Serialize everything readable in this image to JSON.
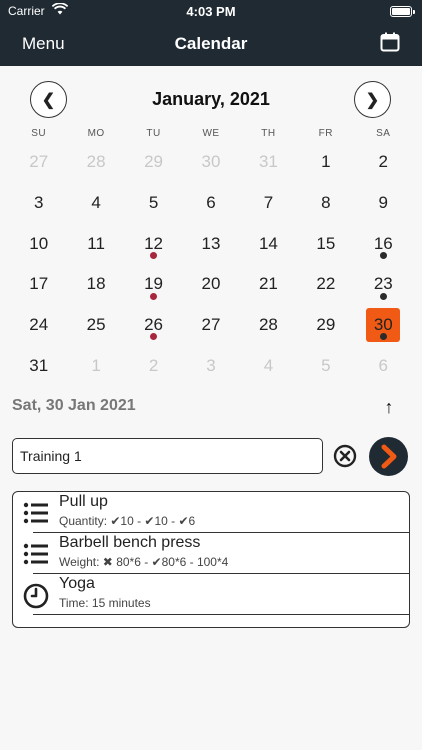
{
  "status_bar": {
    "carrier": "Carrier",
    "time": "4:03 PM",
    "wifi_icon": "wifi-icon",
    "battery_icon": "battery-icon"
  },
  "nav": {
    "left_label": "Menu",
    "title": "Calendar",
    "right_icon": "calendar-icon"
  },
  "month": {
    "title": "January, 2021",
    "prev_icon": "chevron-left-icon",
    "next_icon": "chevron-right-icon"
  },
  "weekdays": [
    "SU",
    "MO",
    "TU",
    "WE",
    "TH",
    "FR",
    "SA"
  ],
  "colors": {
    "nav_bg": "#1f2a33",
    "selected": "#f05a14",
    "dot_red": "#a8263e",
    "dot_dark": "#2b2b2b"
  },
  "days": [
    {
      "n": "27",
      "muted": true
    },
    {
      "n": "28",
      "muted": true
    },
    {
      "n": "29",
      "muted": true
    },
    {
      "n": "30",
      "muted": true
    },
    {
      "n": "31",
      "muted": true
    },
    {
      "n": "1"
    },
    {
      "n": "2"
    },
    {
      "n": "3"
    },
    {
      "n": "4"
    },
    {
      "n": "5"
    },
    {
      "n": "6"
    },
    {
      "n": "7"
    },
    {
      "n": "8"
    },
    {
      "n": "9"
    },
    {
      "n": "10"
    },
    {
      "n": "11"
    },
    {
      "n": "12",
      "dot": "red"
    },
    {
      "n": "13"
    },
    {
      "n": "14"
    },
    {
      "n": "15"
    },
    {
      "n": "16",
      "dot": "dark"
    },
    {
      "n": "17"
    },
    {
      "n": "18"
    },
    {
      "n": "19",
      "dot": "red"
    },
    {
      "n": "20"
    },
    {
      "n": "21"
    },
    {
      "n": "22"
    },
    {
      "n": "23",
      "dot": "dark"
    },
    {
      "n": "24"
    },
    {
      "n": "25"
    },
    {
      "n": "26",
      "dot": "red"
    },
    {
      "n": "27"
    },
    {
      "n": "28"
    },
    {
      "n": "29"
    },
    {
      "n": "30",
      "dot": "dark",
      "selected": true
    },
    {
      "n": "31"
    },
    {
      "n": "1",
      "muted": true
    },
    {
      "n": "2",
      "muted": true
    },
    {
      "n": "3",
      "muted": true
    },
    {
      "n": "4",
      "muted": true
    },
    {
      "n": "5",
      "muted": true
    },
    {
      "n": "6",
      "muted": true
    }
  ],
  "selected_date_label": "Sat, 30 Jan 2021",
  "training": {
    "value": "Training 1",
    "clear_icon": "clear-icon",
    "go_icon": "chevron-right-icon"
  },
  "exercises": [
    {
      "name": "Pull up",
      "detail": "Quantity: ✔10 - ✔10 - ✔6",
      "icon": "list-icon"
    },
    {
      "name": "Barbell bench press",
      "detail": "Weight: ✖ 80*6 - ✔80*6 - 100*4",
      "icon": "list-icon"
    },
    {
      "name": "Yoga",
      "detail": "Time: 15 minutes",
      "icon": "clock-icon"
    }
  ]
}
